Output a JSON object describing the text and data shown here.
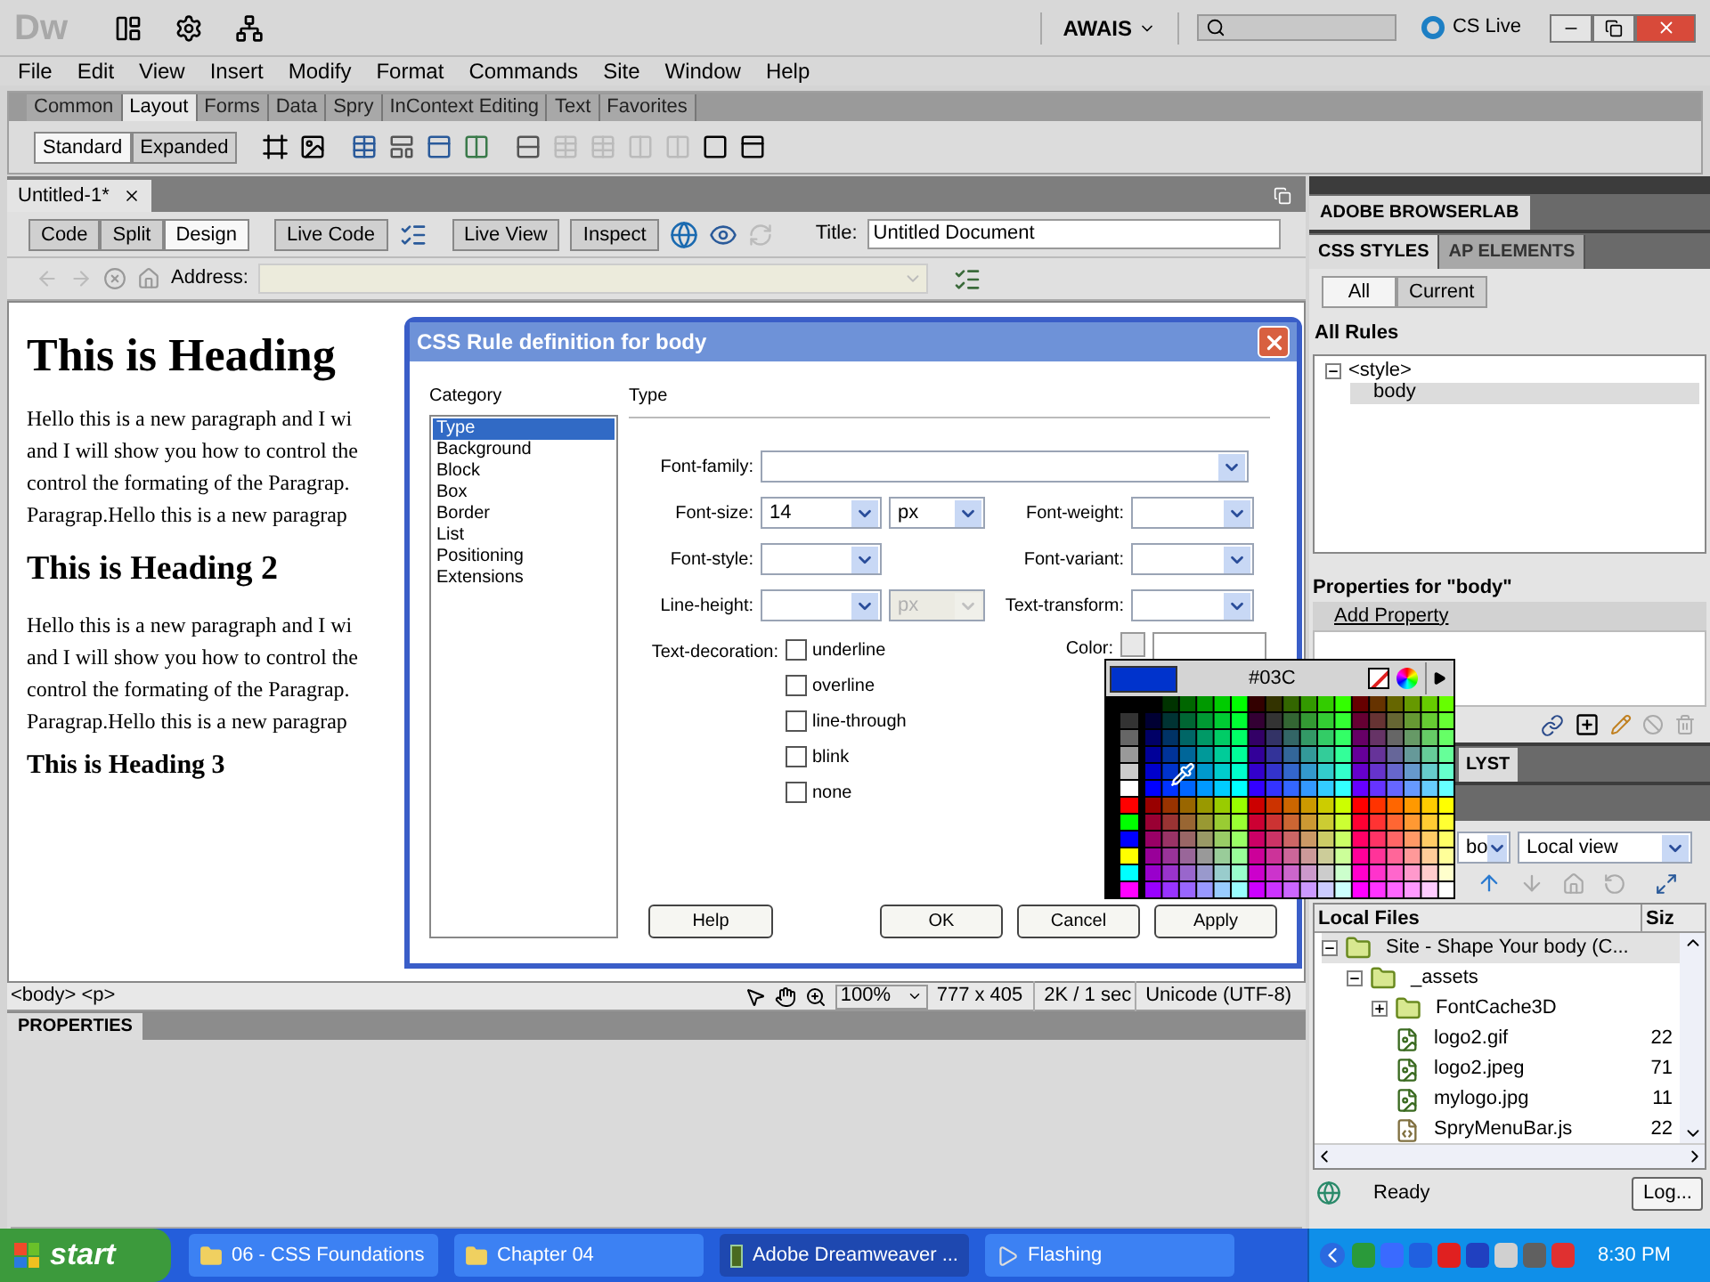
{
  "app": {
    "logo": "Dw",
    "workspace": "AWAIS",
    "cs_live": "CS Live"
  },
  "menu": [
    "File",
    "Edit",
    "View",
    "Insert",
    "Modify",
    "Format",
    "Commands",
    "Site",
    "Window",
    "Help"
  ],
  "insert_tabs": [
    {
      "label": "Common",
      "selected": false
    },
    {
      "label": "Layout",
      "selected": true
    },
    {
      "label": "Forms",
      "selected": false
    },
    {
      "label": "Data",
      "selected": false
    },
    {
      "label": "Spry",
      "selected": false
    },
    {
      "label": "InContext Editing",
      "selected": false
    },
    {
      "label": "Text",
      "selected": false
    },
    {
      "label": "Favorites",
      "selected": false
    }
  ],
  "layout_modes": [
    {
      "label": "Standard",
      "selected": true
    },
    {
      "label": "Expanded",
      "selected": false
    }
  ],
  "document_tab": {
    "title": "Untitled-1*"
  },
  "view_modes": [
    {
      "label": "Code",
      "selected": false
    },
    {
      "label": "Split",
      "selected": false
    },
    {
      "label": "Design",
      "selected": true
    }
  ],
  "live_buttons": [
    "Live Code",
    "Live View",
    "Inspect"
  ],
  "title_field": {
    "label": "Title:",
    "value": "Untitled Document"
  },
  "address": {
    "label": "Address:"
  },
  "document": [
    {
      "kind": "h1",
      "lines": [
        "This is Heading"
      ]
    },
    {
      "kind": "p",
      "lines": [
        "Hello this is a new paragraph and I wi",
        "and I will show you how to control the",
        "control the formating of the Paragrap.",
        "Paragrap.Hello this is a new paragrap"
      ]
    },
    {
      "kind": "h2",
      "lines": [
        "This is Heading 2"
      ]
    },
    {
      "kind": "p",
      "lines": [
        "Hello this is a new paragraph and I wi",
        "and I will show you how to control the",
        "control the formating of the Paragrap.",
        "Paragrap.Hello this is a new paragrap"
      ]
    },
    {
      "kind": "h3",
      "lines": [
        "This is Heading 3"
      ]
    }
  ],
  "status_bar": {
    "tags": "<body> <p>",
    "zoom": "100%",
    "size": "777 x 405",
    "speed": "2K / 1 sec",
    "encoding": "Unicode (UTF-8)"
  },
  "properties_panel": {
    "title": "PROPERTIES"
  },
  "dialog": {
    "title": "CSS Rule definition for body",
    "category_label": "Category",
    "section": "Type",
    "categories": [
      {
        "label": "Type",
        "selected": true
      },
      {
        "label": "Background",
        "selected": false
      },
      {
        "label": "Block",
        "selected": false
      },
      {
        "label": "Box",
        "selected": false
      },
      {
        "label": "Border",
        "selected": false
      },
      {
        "label": "List",
        "selected": false
      },
      {
        "label": "Positioning",
        "selected": false
      },
      {
        "label": "Extensions",
        "selected": false
      }
    ],
    "font_family": {
      "label": "Font-family:"
    },
    "rows": [
      {
        "left": {
          "label": "Font-size:",
          "value": "14",
          "unit": "px",
          "unit_disabled": false
        },
        "right": {
          "label": "Font-weight:"
        }
      },
      {
        "left": {
          "label": "Font-style:"
        },
        "right": {
          "label": "Font-variant:"
        }
      },
      {
        "left": {
          "label": "Line-height:",
          "unit": "px",
          "unit_disabled": true
        },
        "right": {
          "label": "Text-transform:"
        }
      }
    ],
    "decoration_label": "Text-decoration:",
    "decorations": [
      {
        "label": "underline",
        "checked": false
      },
      {
        "label": "overline",
        "checked": false
      },
      {
        "label": "line-through",
        "checked": false
      },
      {
        "label": "blink",
        "checked": false
      },
      {
        "label": "none",
        "checked": false
      }
    ],
    "color_label": "Color:",
    "help": "Help",
    "buttons": [
      "OK",
      "Cancel",
      "Apply"
    ]
  },
  "color_picker": {
    "hex": "#03C",
    "color": "#0033cc"
  },
  "right_panel": {
    "browserlab": "ADOBE BROWSERLAB",
    "tabs": [
      {
        "label": "CSS STYLES",
        "selected": true
      },
      {
        "label": "AP ELEMENTS",
        "selected": false
      }
    ],
    "modes": [
      {
        "label": "All",
        "selected": true
      },
      {
        "label": "Current",
        "selected": false
      }
    ],
    "rules_title": "All Rules",
    "rules": [
      {
        "label": "<style>",
        "expanded": true,
        "selected": false,
        "children": [
          {
            "label": "body",
            "selected": true
          }
        ]
      }
    ],
    "properties_title": "Properties for \"body\"",
    "add_property": "Add Property",
    "analyst_tab": "LYST",
    "site_select": "bo",
    "view_select": "Local view",
    "files_columns": [
      "Local Files",
      "Siz"
    ],
    "files": [
      {
        "kind": "site",
        "label": "Site - Shape Your body (C...",
        "expanded": true,
        "children": [
          {
            "kind": "folder",
            "label": "_assets",
            "expanded": true,
            "children": [
              {
                "kind": "folder",
                "label": "FontCache3D",
                "expanded": false
              },
              {
                "kind": "image",
                "label": "logo2.gif",
                "size": "22"
              },
              {
                "kind": "image",
                "label": "logo2.jpeg",
                "size": "71"
              },
              {
                "kind": "image",
                "label": "mylogo.jpg",
                "size": "11"
              },
              {
                "kind": "script",
                "label": "SpryMenuBar.js",
                "size": "22"
              }
            ]
          }
        ]
      }
    ],
    "status": "Ready",
    "log_button": "Log..."
  },
  "taskbar": {
    "start": "start",
    "tasks": [
      {
        "label": "06 - CSS Foundations",
        "kind": "folder",
        "active": false
      },
      {
        "label": "Chapter 04",
        "kind": "folder",
        "active": false
      },
      {
        "label": "Adobe Dreamweaver ...",
        "kind": "app",
        "active": true
      },
      {
        "label": "Flashing",
        "kind": "app2",
        "active": false
      }
    ],
    "clock": "8:30 PM"
  }
}
